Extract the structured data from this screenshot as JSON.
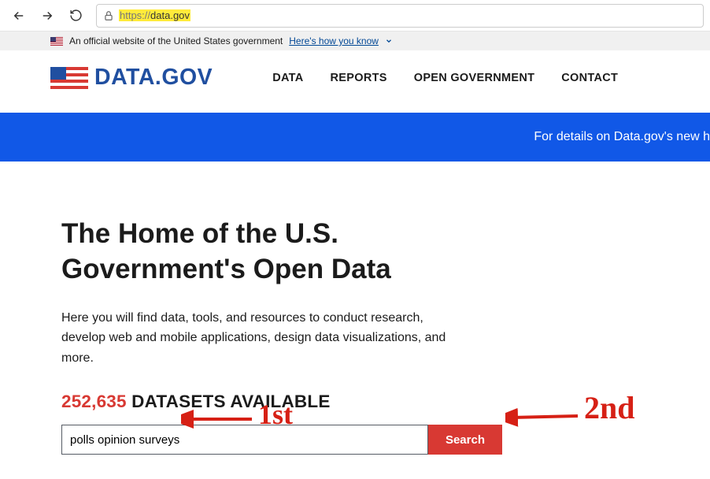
{
  "browser": {
    "url_prefix": "https://",
    "url_domain": "data.gov"
  },
  "gov_banner": {
    "text": "An official website of the United States government",
    "link": "Here's how you know"
  },
  "logo": {
    "text": "DATA.GOV"
  },
  "nav": {
    "items": [
      "DATA",
      "REPORTS",
      "OPEN GOVERNMENT",
      "CONTACT"
    ]
  },
  "blue_banner": {
    "text": "For details on Data.gov's new h"
  },
  "hero": {
    "title": "The Home of the U.S. Government's Open Data",
    "subtitle": "Here you will find data, tools, and resources to conduct research, develop web and mobile applications, design data visualizations, and more.",
    "dataset_count": "252,635",
    "dataset_label": " DATASETS AVAILABLE"
  },
  "search": {
    "value": "polls opinion surveys",
    "button": "Search"
  },
  "annotations": {
    "first": "1st",
    "second": "2nd"
  }
}
